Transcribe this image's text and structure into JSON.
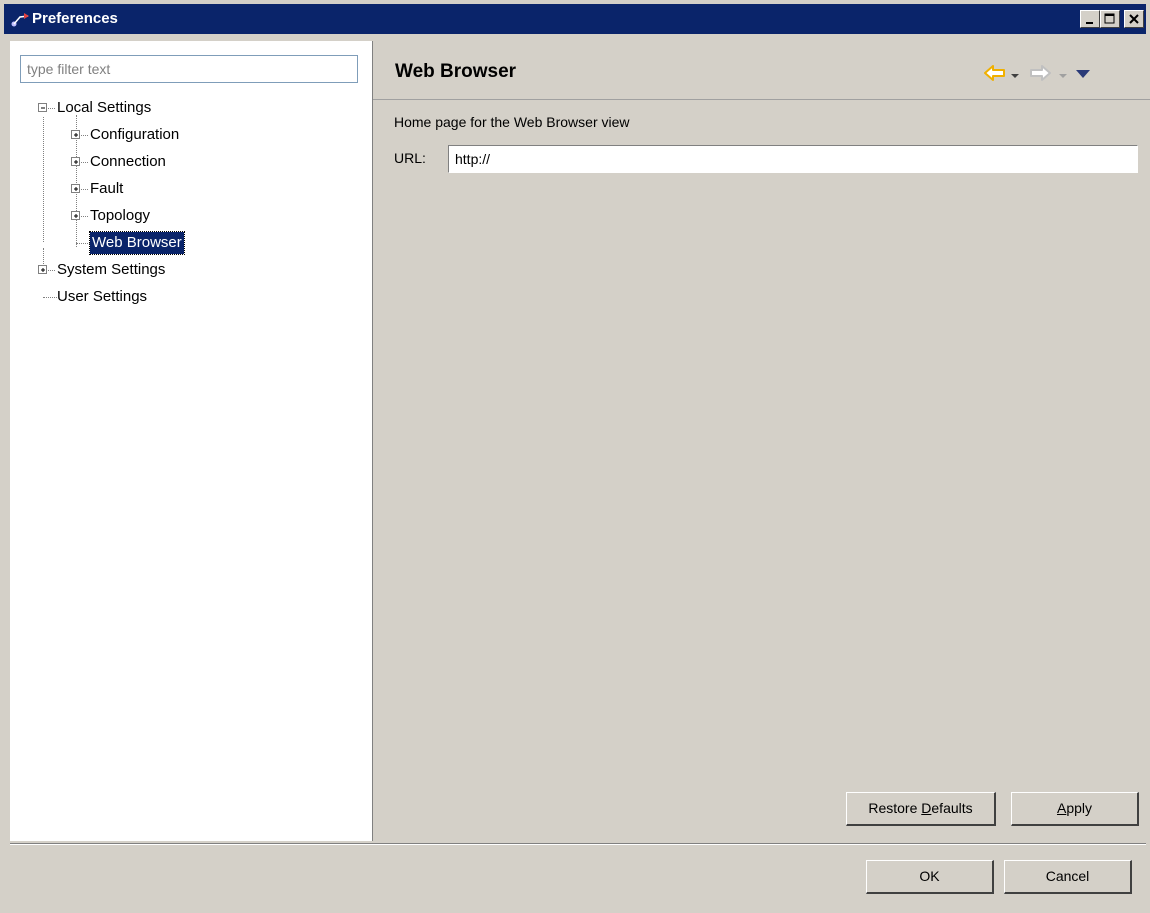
{
  "window": {
    "title": "Preferences"
  },
  "filter": {
    "placeholder": "type filter text"
  },
  "tree": {
    "local_settings": "Local Settings",
    "configuration": "Configuration",
    "connection": "Connection",
    "fault": "Fault",
    "topology": "Topology",
    "web_browser": "Web Browser",
    "system_settings": "System Settings",
    "user_settings": "User Settings"
  },
  "page": {
    "title": "Web Browser",
    "description": "Home page for the Web Browser view",
    "url_label": "URL:",
    "url_value": "http://"
  },
  "buttons": {
    "restore_prefix": "Restore ",
    "restore_underlined": "D",
    "restore_suffix": "efaults",
    "apply_underlined": "A",
    "apply_suffix": "pply",
    "ok": "OK",
    "cancel": "Cancel"
  },
  "icons": {
    "back": "back-arrow-icon",
    "back_menu": "chevron-down-icon",
    "forward": "forward-arrow-icon",
    "forward_menu": "chevron-down-icon",
    "view_menu": "view-menu-icon"
  },
  "colors": {
    "titlebar": "#0a246a",
    "selection": "#0a246a",
    "dialog_bg": "#d4d0c8",
    "back_arrow": "#f0b000"
  }
}
